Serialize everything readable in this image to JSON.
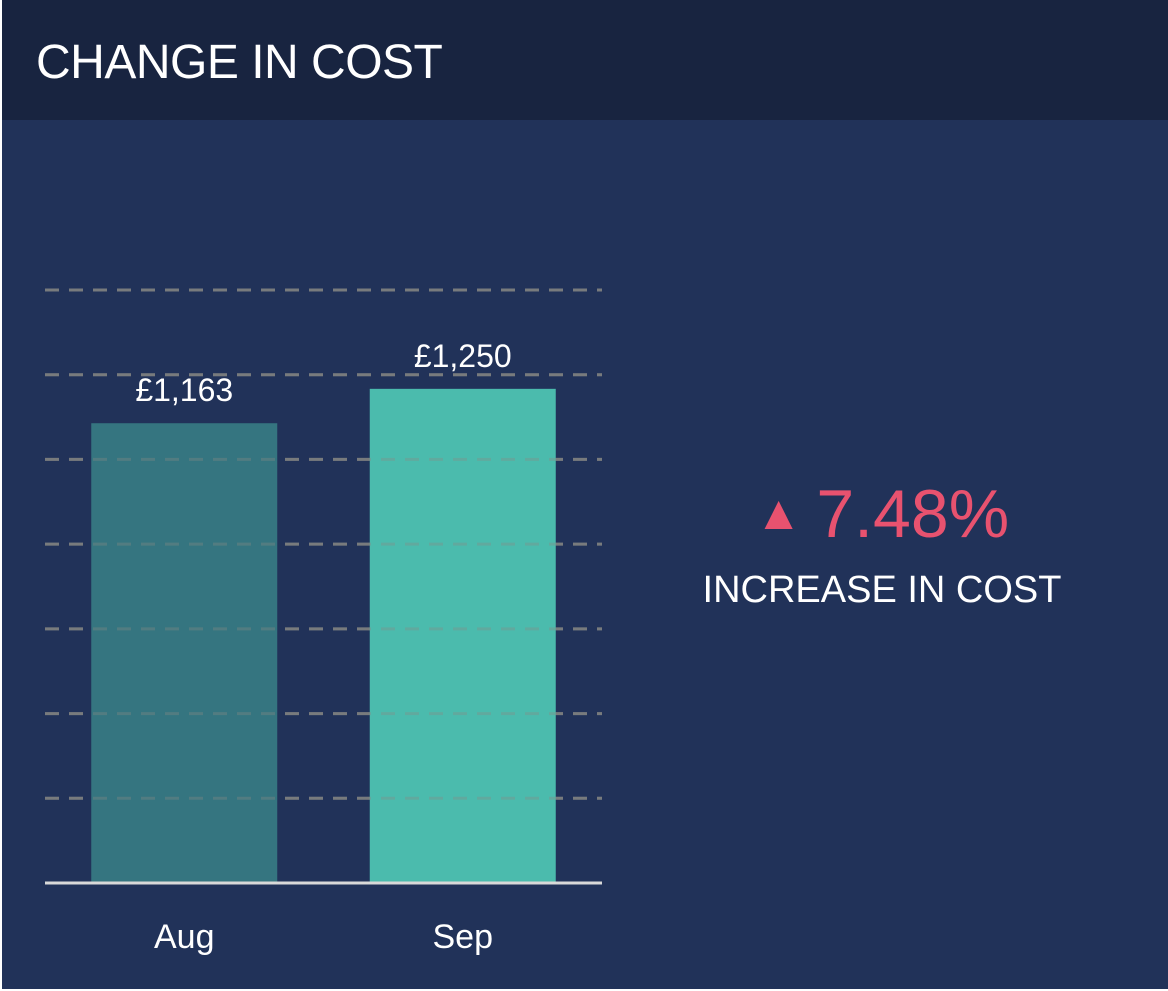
{
  "title": "CHANGE IN COST",
  "chart_data": {
    "type": "bar",
    "categories": [
      "Aug",
      "Sep"
    ],
    "values": [
      1163,
      1250
    ],
    "value_labels": [
      "£1,163",
      "£1,250"
    ],
    "bar_colors": [
      "#357580",
      "#4bbbad"
    ],
    "ylim": [
      0,
      1500
    ],
    "grid": true,
    "xlabel": "",
    "ylabel": ""
  },
  "kpi": {
    "arrow": "▲",
    "value": "7.48%",
    "label": "INCREASE IN COST",
    "color": "#e8526f"
  },
  "colors": {
    "background": "#213259",
    "header": "#182440",
    "text": "#ffffff",
    "gridline": "#8a8a85",
    "baseline": "#d9d9d9"
  }
}
